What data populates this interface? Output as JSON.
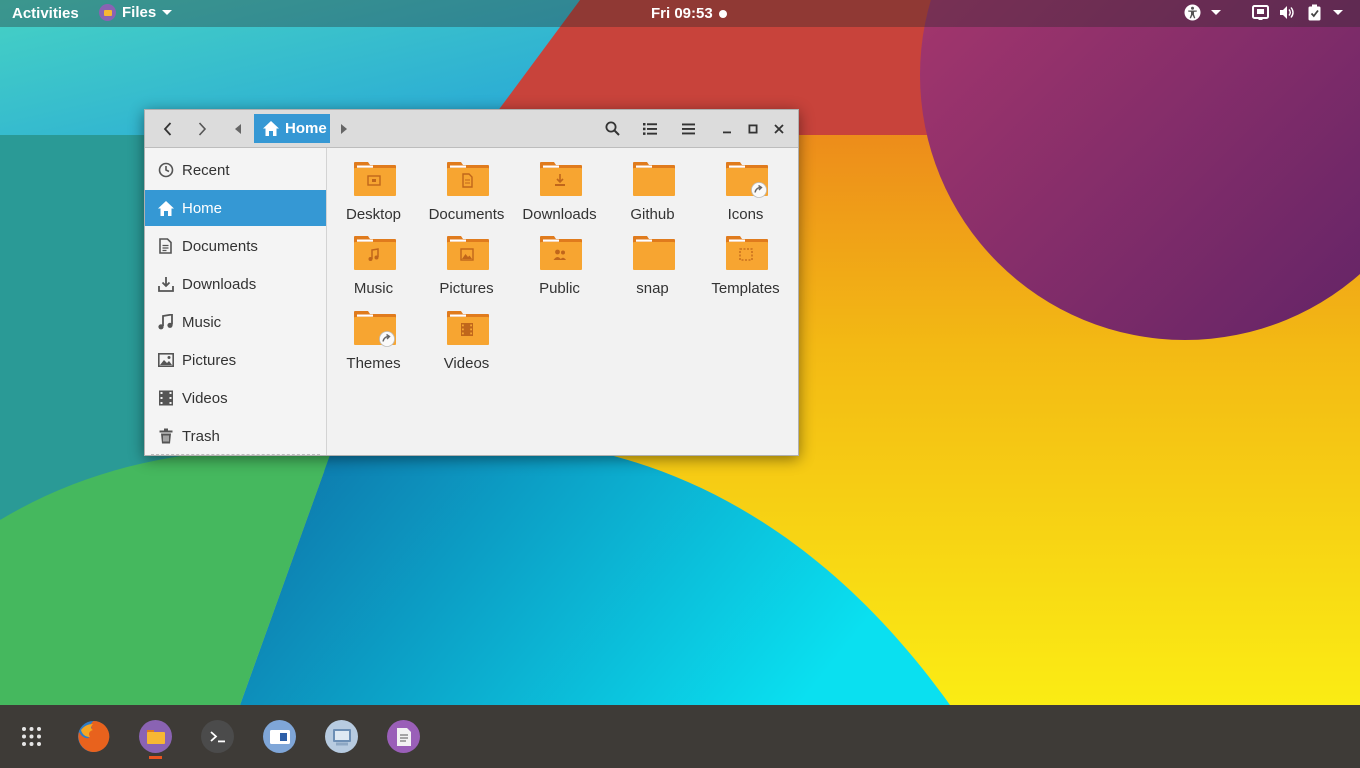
{
  "topbar": {
    "activities": "Activities",
    "app_name": "Files",
    "clock": "Fri 09:53"
  },
  "window": {
    "nav": {
      "back_icon": "chevron-left-icon",
      "forward_icon": "chevron-right-icon"
    },
    "pathbar": {
      "current": "Home"
    },
    "sidebar": {
      "items": [
        {
          "label": "Recent",
          "icon": "clock-icon"
        },
        {
          "label": "Home",
          "icon": "home-icon",
          "active": true
        },
        {
          "label": "Documents",
          "icon": "document-icon"
        },
        {
          "label": "Downloads",
          "icon": "download-icon"
        },
        {
          "label": "Music",
          "icon": "music-icon"
        },
        {
          "label": "Pictures",
          "icon": "picture-icon"
        },
        {
          "label": "Videos",
          "icon": "video-icon"
        },
        {
          "label": "Trash",
          "icon": "trash-icon"
        }
      ]
    },
    "files": [
      {
        "name": "Desktop",
        "emblem": "desktop"
      },
      {
        "name": "Documents",
        "emblem": "document"
      },
      {
        "name": "Downloads",
        "emblem": "download"
      },
      {
        "name": "Github",
        "emblem": "none"
      },
      {
        "name": "Icons",
        "emblem": "symlink"
      },
      {
        "name": "Music",
        "emblem": "music"
      },
      {
        "name": "Pictures",
        "emblem": "picture"
      },
      {
        "name": "Public",
        "emblem": "people"
      },
      {
        "name": "snap",
        "emblem": "none"
      },
      {
        "name": "Templates",
        "emblem": "template"
      },
      {
        "name": "Themes",
        "emblem": "symlink"
      },
      {
        "name": "Videos",
        "emblem": "video"
      }
    ]
  },
  "dock": {
    "items": [
      {
        "name": "show-applications",
        "icon": "app-grid-icon"
      },
      {
        "name": "firefox",
        "icon": "firefox-icon"
      },
      {
        "name": "files",
        "icon": "files-icon",
        "running": true
      },
      {
        "name": "terminal",
        "icon": "terminal-icon"
      },
      {
        "name": "software",
        "icon": "software-icon"
      },
      {
        "name": "screenshot",
        "icon": "screenshot-icon"
      },
      {
        "name": "text-editor",
        "icon": "text-editor-icon"
      }
    ]
  },
  "colors": {
    "accent": "#3598d4",
    "folder": "#f7a531",
    "folder_tab": "#e07b1d",
    "dock": "#3e3b37",
    "running_indicator": "#e95420"
  }
}
